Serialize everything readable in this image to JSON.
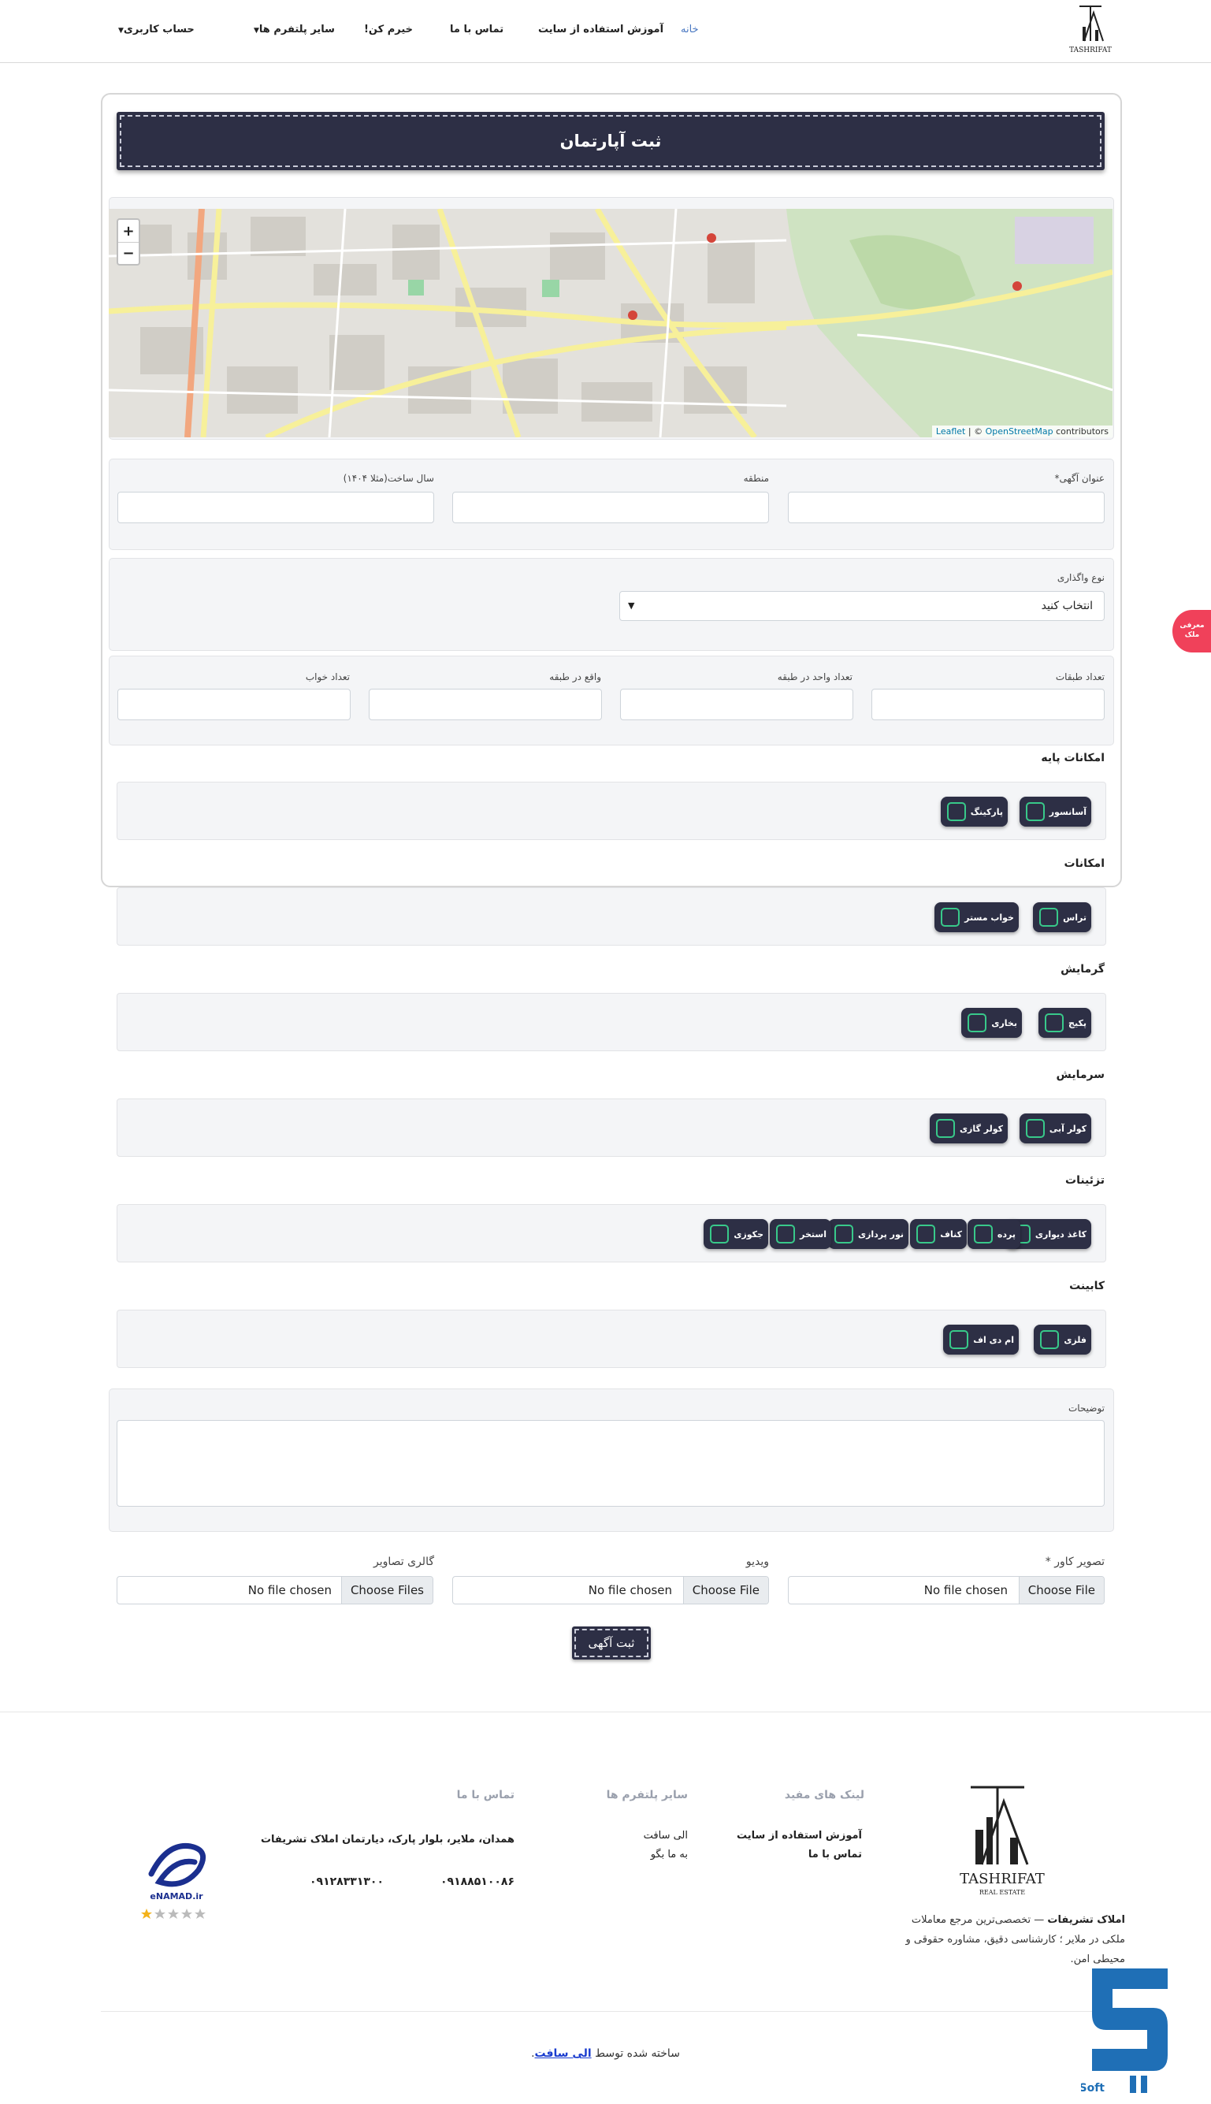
{
  "header": {
    "logo_text": "TASHRIFAT",
    "nav": {
      "home": "خانه",
      "tutorial": "آموزش استفاده از سایت",
      "contact": "تماس با ما",
      "buy": "خیرم کن!",
      "platforms": "سایر پلتفرم ها",
      "account": "حساب کاربری"
    }
  },
  "form": {
    "title": "ثبت آپارتمان",
    "map": {
      "zoom_in": "+",
      "zoom_out": "−",
      "attribution_leaflet": "Leaflet",
      "attribution_sep": " | © ",
      "attribution_osm": "OpenStreetMap",
      "attribution_contrib": " contributors"
    },
    "fields": {
      "ad_title": "عنوان آگهی*",
      "region": "منطقه",
      "build_year": "سال ساخت(مثلا ۱۴۰۴)",
      "transfer_type": "نوع واگذاری",
      "transfer_select": "انتخاب کنید",
      "floors_count": "تعداد طبقات",
      "units_per_floor": "تعداد واحد در طبقه",
      "floor_located": "واقع در طبقه",
      "bedrooms": "تعداد خواب"
    },
    "groups": {
      "basic": {
        "title": "امکانات پایه",
        "options": [
          "آسانسور",
          "پارکینگ"
        ]
      },
      "amenities": {
        "title": "امکانات",
        "options": [
          "تراس",
          "خواب مستر"
        ]
      },
      "heating": {
        "title": "گرمایش",
        "options": [
          "پکیج",
          "بخاری"
        ]
      },
      "cooling": {
        "title": "سرمایش",
        "options": [
          "کولر آبی",
          "کولر گازی"
        ]
      },
      "decor": {
        "title": "تزئینات",
        "options": [
          "کاغذ دیواری",
          "پرده",
          "کناف",
          "نور پردازی",
          "استخر",
          "جکوزی"
        ]
      },
      "cabinet": {
        "title": "کابینت",
        "options": [
          "فلزی",
          "ام دی اف"
        ]
      }
    },
    "description_label": "توضیحات",
    "uploads": {
      "cover": "تصویر کاور *",
      "video": "ویدیو",
      "gallery": "گالری تصاویر",
      "choose_file": "Choose File",
      "choose_files": "Choose Files",
      "no_file": "No file chosen"
    },
    "submit": "ثبت آگهی"
  },
  "float_button": "معرفی ملک",
  "footer": {
    "useful_links": {
      "title": "لینک های مفید",
      "items": [
        "آموزش استفاده از سایت",
        "تماس با ما"
      ]
    },
    "platforms": {
      "title": "سایر پلتفرم ها",
      "items": [
        "الی سافت",
        "به ما بگو"
      ]
    },
    "contact": {
      "title": "تماس با ما",
      "address": "همدان، ملایر، بلوار پارک، دیارتمان املاک تشریفات",
      "phone1": "۰۹۱۸۸۵۱۰۰۸۶",
      "phone2": "۰۹۱۲۸۳۳۱۳۰۰"
    },
    "about_brand": "املاک تشریفات",
    "about_text": " — تخصصی‌ترین مرجع معاملات ملکی در ملایر ؛ کارشناسی دقیق، مشاوره حقوقی و محیطی امن.",
    "logo_text": "TASHRIFAT",
    "logo_sub": "REAL ESTATE",
    "enamad": "eNAMAD.ir",
    "credit_prefix": "ساخته شده توسط ",
    "credit_link": "الی سافت",
    "credit_suffix": ".",
    "soft_logo": "Soft"
  },
  "colors": {
    "primary_dark": "#2d2f45",
    "checkbox_accent": "#38c98a",
    "float_red": "#f0415a",
    "link_blue": "#1a3ccf"
  }
}
